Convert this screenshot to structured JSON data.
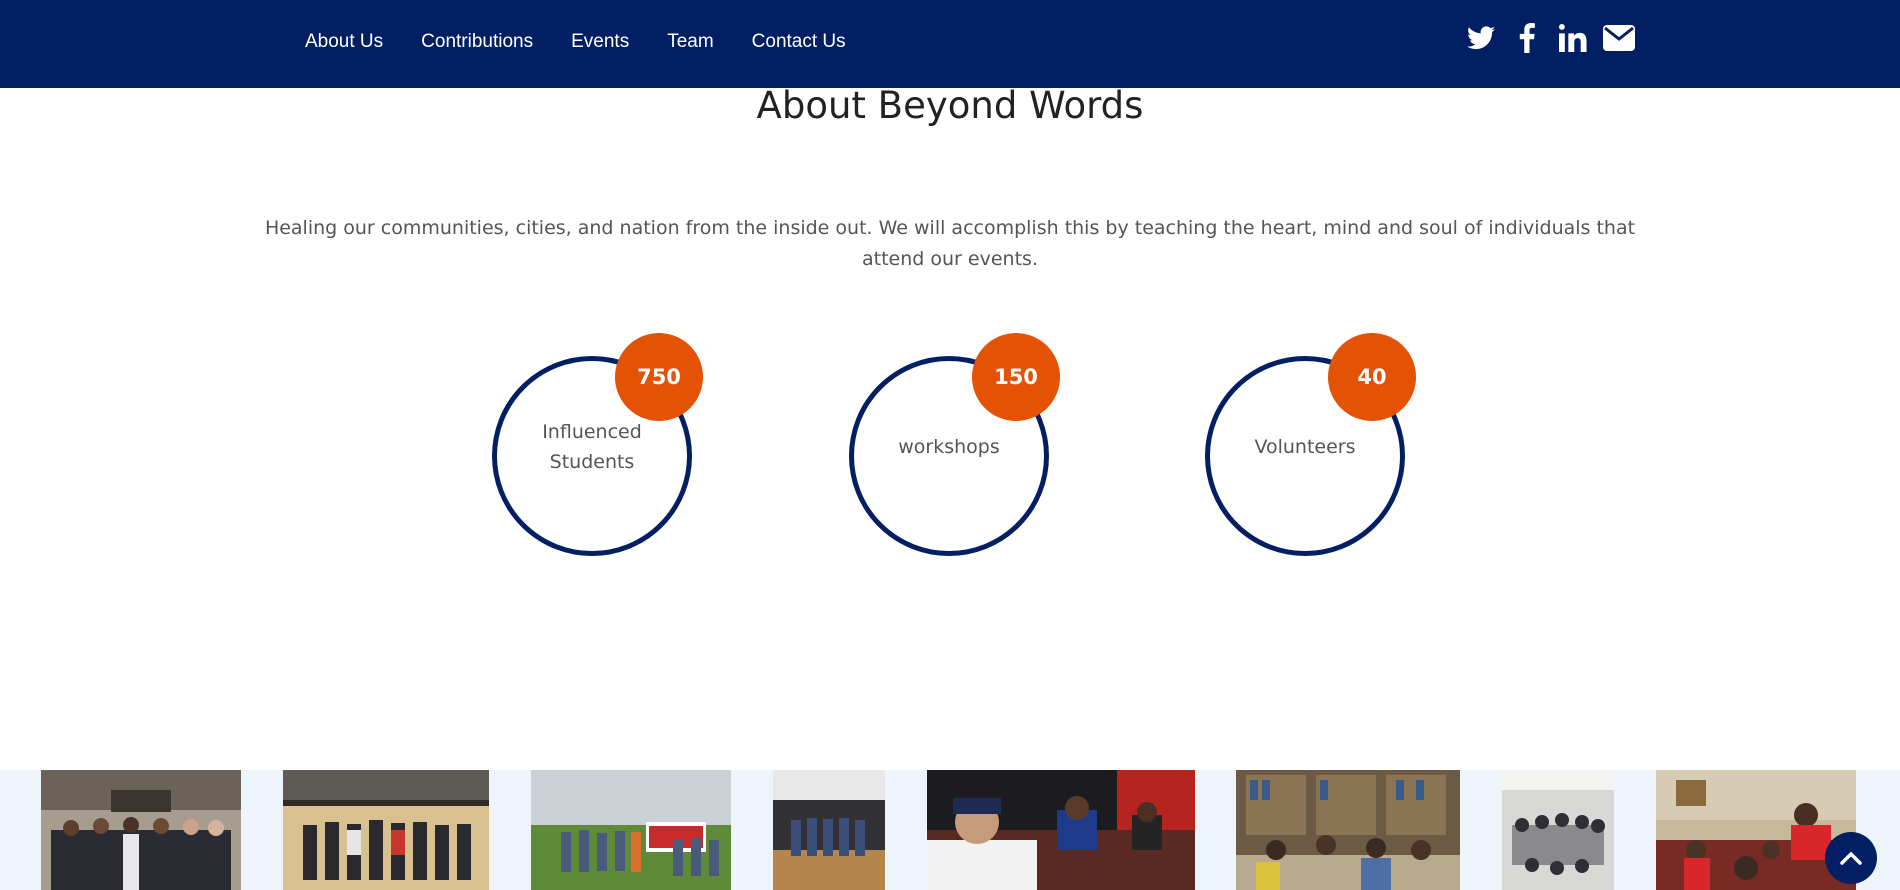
{
  "nav": {
    "links": [
      "About Us",
      "Contributions",
      "Events",
      "Team",
      "Contact Us"
    ],
    "social_icons": [
      "twitter-icon",
      "facebook-icon",
      "linkedin-icon",
      "envelope-icon"
    ]
  },
  "about": {
    "title": "About Beyond Words",
    "description": "Healing our communities, cities, and nation from the inside out. We will accomplish this by teaching the heart, mind and soul of individuals that attend our events."
  },
  "stats": [
    {
      "value": "750",
      "label": "Influenced Students"
    },
    {
      "value": "150",
      "label": "workshops"
    },
    {
      "value": "40",
      "label": "Volunteers"
    }
  ],
  "gallery": {
    "photos": [
      "group-photo-building",
      "group-photo-gym",
      "group-photo-animal-hospital",
      "group-photo-hallway",
      "kids-writing-photo",
      "library-meeting-photo",
      "classroom-photo",
      "table-discussion-photo"
    ]
  },
  "back_to_top_icon": "chevron-up-icon",
  "colors": {
    "navbar": "#011f62",
    "accent": "#e35205",
    "circle_border": "#011f62",
    "gallery_bg": "#eef4fb"
  }
}
